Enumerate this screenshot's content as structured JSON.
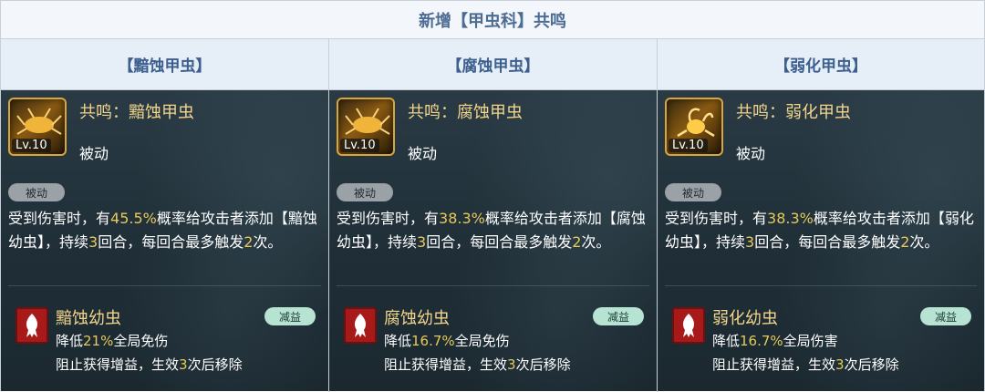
{
  "header": {
    "title": "新增【甲虫科】共鸣"
  },
  "colors": {
    "accent_gold": "#f2d48a",
    "highlight": "#e6c95a",
    "header_blue": "#3d5f8d",
    "debuff_red": "#a81a1a"
  },
  "columns": [
    {
      "heading": "【黯蚀甲虫】",
      "skill": {
        "name": "共鸣：黯蚀甲虫",
        "level": "Lv.10",
        "type": "被动",
        "icon": "beetle-icon"
      },
      "tag": "被动",
      "desc": {
        "p1": "受到伤害时，有",
        "rate": "45.5%",
        "p2": "概率给攻击者添加【黯蚀幼虫】，持续",
        "turns": "3",
        "p3": "回合，每回合最多触发",
        "times": "2",
        "p4": "次。"
      },
      "debuff": {
        "name": "黯蚀幼虫",
        "tag": "减益",
        "icon": "larva-debuff-icon",
        "line1_a": "降低",
        "line1_val": "21%",
        "line1_b": "全局免伤",
        "line2_a": "阻止获得增益，生效",
        "line2_val": "3",
        "line2_b": "次后移除"
      }
    },
    {
      "heading": "【腐蚀甲虫】",
      "skill": {
        "name": "共鸣：腐蚀甲虫",
        "level": "Lv.10",
        "type": "被动",
        "icon": "beetle-icon"
      },
      "tag": "被动",
      "desc": {
        "p1": "受到伤害时，有",
        "rate": "38.3%",
        "p2": "概率给攻击者添加【腐蚀幼虫】，持续",
        "turns": "3",
        "p3": "回合，每回合最多触发",
        "times": "2",
        "p4": "次。"
      },
      "debuff": {
        "name": "腐蚀幼虫",
        "tag": "减益",
        "icon": "larva-debuff-icon",
        "line1_a": "降低",
        "line1_val": "16.7%",
        "line1_b": "全局免伤",
        "line2_a": "阻止获得增益，生效",
        "line2_val": "3",
        "line2_b": "次后移除"
      }
    },
    {
      "heading": "【弱化甲虫】",
      "skill": {
        "name": "共鸣：弱化甲虫",
        "level": "Lv.10",
        "type": "被动",
        "icon": "scorpion-beetle-icon"
      },
      "tag": "被动",
      "desc": {
        "p1": "受到伤害时，有",
        "rate": "38.3%",
        "p2": "概率给攻击者添加【弱化幼虫】，持续",
        "turns": "3",
        "p3": "回合，每回合最多触发",
        "times": "2",
        "p4": "次。"
      },
      "debuff": {
        "name": "弱化幼虫",
        "tag": "减益",
        "icon": "larva-debuff-icon",
        "line1_a": "降低",
        "line1_val": "16.7%",
        "line1_b": "全局伤害",
        "line2_a": "阻止获得增益，生效",
        "line2_val": "3",
        "line2_b": "次后移除"
      }
    }
  ]
}
